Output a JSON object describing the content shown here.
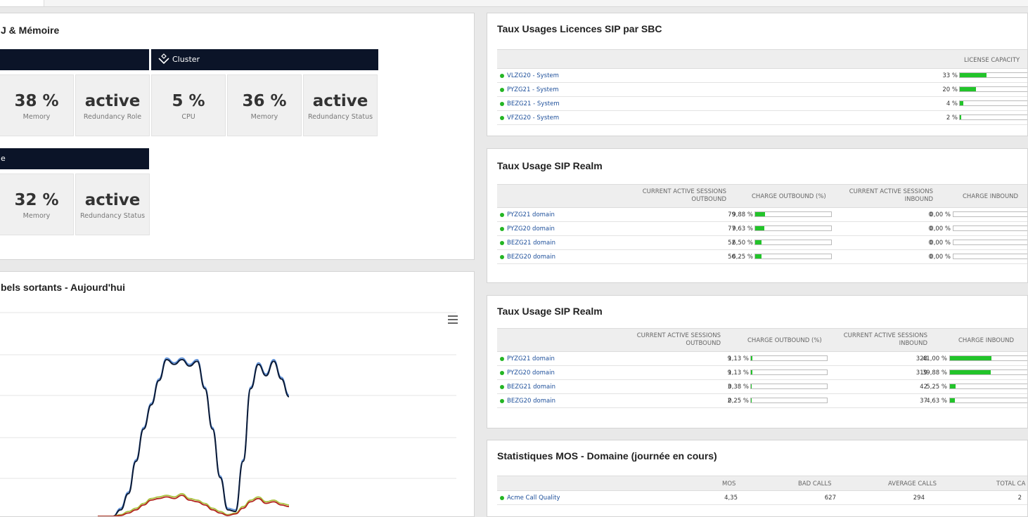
{
  "cpu_panel": {
    "title": "J & Mémoire",
    "groups": [
      {
        "label": ""
      },
      {
        "label": "Cluster"
      },
      {
        "label": "e"
      }
    ],
    "tiles": [
      {
        "value": "38 %",
        "caption": "Memory"
      },
      {
        "value": "active",
        "caption": "Redundancy Role"
      },
      {
        "value": "5 %",
        "caption": "CPU"
      },
      {
        "value": "36 %",
        "caption": "Memory"
      },
      {
        "value": "active",
        "caption": "Redundancy Status"
      },
      {
        "value": "32 %",
        "caption": "Memory"
      },
      {
        "value": "active",
        "caption": "Redundancy Status"
      }
    ]
  },
  "calls_panel": {
    "title": "bels sortants - Aujourd'hui",
    "menu_icon": "hamburger-menu-icon",
    "chart_data": {
      "type": "line",
      "series": [
        {
          "color": "#5b8fd8",
          "values": [
            0,
            0,
            0,
            0.05,
            0.15,
            0.35,
            0.55,
            0.7,
            0.85,
            0.98,
            0.95,
            0.98,
            0.94,
            0.97,
            0.8,
            0.55,
            0.25,
            0.05,
            0.04,
            0.35,
            0.8,
            0.95,
            0.88,
            0.97,
            0.86,
            0.75
          ]
        },
        {
          "color": "#0b1a36",
          "values": [
            0,
            0,
            0,
            0.04,
            0.14,
            0.34,
            0.54,
            0.69,
            0.84,
            0.97,
            0.94,
            0.97,
            0.93,
            0.96,
            0.79,
            0.54,
            0.24,
            0.04,
            0.03,
            0.34,
            0.79,
            0.94,
            0.87,
            0.96,
            0.85,
            0.74
          ]
        },
        {
          "color": "#a9c23f",
          "values": [
            0,
            0,
            0,
            0.01,
            0.03,
            0.05,
            0.08,
            0.11,
            0.12,
            0.13,
            0.12,
            0.14,
            0.11,
            0.1,
            0.08,
            0.05,
            0.03,
            0.01,
            0.02,
            0.06,
            0.1,
            0.12,
            0.09,
            0.1,
            0.08,
            0.07
          ]
        },
        {
          "color": "#b3241e",
          "values": [
            0,
            0,
            0,
            0.005,
            0.02,
            0.04,
            0.07,
            0.1,
            0.11,
            0.12,
            0.11,
            0.13,
            0.1,
            0.09,
            0.07,
            0.04,
            0.02,
            0.005,
            0.015,
            0.05,
            0.09,
            0.11,
            0.08,
            0.09,
            0.07,
            0.06
          ]
        }
      ]
    }
  },
  "licences_panel": {
    "title": "Taux Usages Licences SIP par SBC",
    "header": "LICENSE CAPACITY",
    "rows": [
      {
        "name": "VLZG20 - System",
        "value": "33 %",
        "pct": 33
      },
      {
        "name": "PYZG21 - System",
        "value": "20 %",
        "pct": 20
      },
      {
        "name": "BEZG21 - System",
        "value": "4 %",
        "pct": 4
      },
      {
        "name": "VFZG20 - System",
        "value": "2 %",
        "pct": 2
      }
    ]
  },
  "realm_panel_1": {
    "title": "Taux Usage SIP Realm",
    "headers": {
      "out_sessions": "CURRENT ACTIVE SESSIONS OUTBOUND",
      "out_charge": "CHARGE OUTBOUND (%)",
      "in_sessions": "CURRENT ACTIVE SESSIONS INBOUND",
      "in_charge": "CHARGE INBOUND"
    },
    "rows": [
      {
        "name": "PYZG21 domain",
        "out": "79",
        "out_pct": "9,88 %",
        "out_fill": 9.88,
        "in": "0",
        "in_pct": "0,00 %",
        "in_fill": 0
      },
      {
        "name": "PYZG20 domain",
        "out": "77",
        "out_pct": "9,63 %",
        "out_fill": 9.63,
        "in": "0",
        "in_pct": "0,00 %",
        "in_fill": 0
      },
      {
        "name": "BEZG21 domain",
        "out": "52",
        "out_pct": "6,50 %",
        "out_fill": 6.5,
        "in": "0",
        "in_pct": "0,00 %",
        "in_fill": 0
      },
      {
        "name": "BEZG20 domain",
        "out": "50",
        "out_pct": "6,25 %",
        "out_fill": 6.25,
        "in": "0",
        "in_pct": "0,00 %",
        "in_fill": 0
      }
    ]
  },
  "realm_panel_2": {
    "title": "Taux Usage SIP Realm",
    "headers": {
      "out_sessions": "CURRENT ACTIVE SESSIONS OUTBOUND",
      "out_charge": "CHARGE OUTBOUND (%)",
      "in_sessions": "CURRENT ACTIVE SESSIONS INBOUND",
      "in_charge": "CHARGE INBOUND"
    },
    "rows": [
      {
        "name": "PYZG21 domain",
        "out": "9",
        "out_pct": "1,13 %",
        "out_fill": 1.13,
        "in": "328",
        "in_pct": "41,00 %",
        "in_fill": 41
      },
      {
        "name": "PYZG20 domain",
        "out": "9",
        "out_pct": "1,13 %",
        "out_fill": 1.13,
        "in": "319",
        "in_pct": "39,88 %",
        "in_fill": 39.88
      },
      {
        "name": "BEZG21 domain",
        "out": "3",
        "out_pct": "0,38 %",
        "out_fill": 0.38,
        "in": "42",
        "in_pct": "5,25 %",
        "in_fill": 5.25
      },
      {
        "name": "BEZG20 domain",
        "out": "2",
        "out_pct": "0,25 %",
        "out_fill": 0.25,
        "in": "37",
        "in_pct": "4,63 %",
        "in_fill": 4.63
      }
    ]
  },
  "mos_panel": {
    "title": "Statistiques MOS - Domaine (journée en cours)",
    "headers": {
      "mos": "MOS",
      "bad": "BAD CALLS",
      "avg": "AVERAGE CALLS",
      "total": "TOTAL CA"
    },
    "rows": [
      {
        "name": "Acme Call Quality",
        "mos": "4,35",
        "bad": "627",
        "avg": "294",
        "total": "2"
      }
    ]
  },
  "colors": {
    "header_dark": "#0b1428",
    "bar_green": "#22c42a",
    "status_dot": "#23b523",
    "link_blue": "#1d4f9a"
  }
}
